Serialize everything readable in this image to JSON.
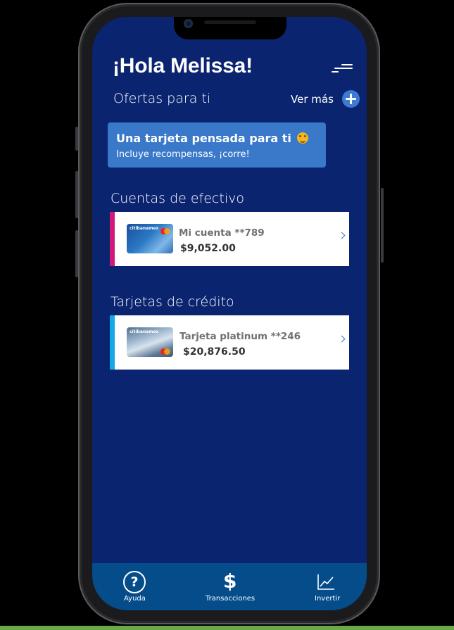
{
  "header": {
    "greeting": "¡Hola Melissa!",
    "menu_icon": "menu-icon"
  },
  "offers": {
    "title": "Ofertas para ti",
    "see_more": "Ver más",
    "banner": {
      "title": "Una tarjeta pensada para ti",
      "subtitle": "Incluye recompensas, ¡corre!",
      "emoji": "star-struck-emoji"
    }
  },
  "cash_accounts": {
    "title": "Cuentas de efectivo",
    "items": [
      {
        "name": "Mi cuenta **789",
        "amount": "$9,052.00",
        "brand": "citibanamex",
        "accent": "#d1197a"
      }
    ]
  },
  "credit_cards": {
    "title": "Tarjetas de crédito",
    "items": [
      {
        "name": "Tarjeta platinum **246",
        "amount": "$20,876.50",
        "brand": "citibanamex",
        "accent": "#15a8e8"
      }
    ]
  },
  "bottom_nav": [
    {
      "label": "Ayuda",
      "icon": "help-icon"
    },
    {
      "label": "Transacciones",
      "icon": "dollar-icon"
    },
    {
      "label": "Invertir",
      "icon": "chart-line-icon"
    }
  ],
  "colors": {
    "screen_bg": "#0b2470",
    "banner_bg": "#3a78c9",
    "nav_bg": "#044c8a",
    "accent_blue": "#3c7ad6"
  }
}
